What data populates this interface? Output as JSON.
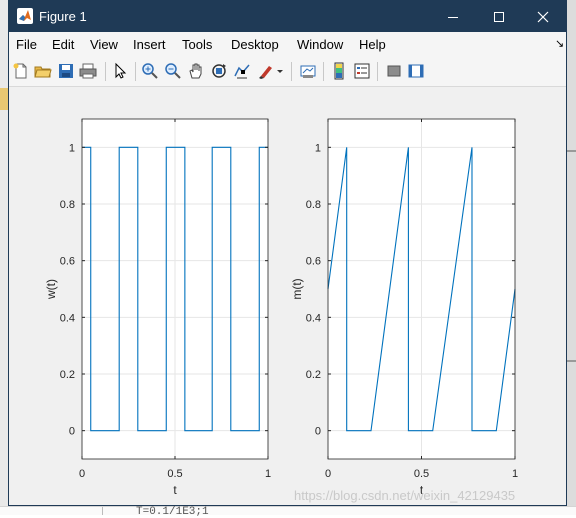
{
  "window": {
    "title": "Figure 1"
  },
  "menu": [
    "File",
    "Edit",
    "View",
    "Insert",
    "Tools",
    "Desktop",
    "Window",
    "Help"
  ],
  "toolbar": [
    "new-figure-icon",
    "open-file-icon",
    "save-icon",
    "print-icon",
    "pointer-icon",
    "zoom-in-icon",
    "zoom-out-icon",
    "pan-icon",
    "rotate-3d-icon",
    "data-cursor-icon",
    "brush-icon",
    "brush-dropdown-icon",
    "link-plot-icon",
    "colorbar-icon",
    "legend-icon",
    "hide-plot-tools-icon",
    "show-plot-tools-icon"
  ],
  "background_code": "T=0.1/1E3;1",
  "watermark": "https://blog.csdn.net/weixin_42129435",
  "chart_data": [
    {
      "type": "line",
      "xlabel": "t",
      "ylabel": "w(t)",
      "xlim": [
        0,
        1
      ],
      "ylim": [
        -0.1,
        1.1
      ],
      "xticks": [
        "0",
        "0.5",
        "1"
      ],
      "yticks": [
        "0",
        "0.2",
        "0.4",
        "0.6",
        "0.8",
        "1"
      ],
      "grid": true,
      "color": "#0072bd",
      "x": [
        0,
        0.047,
        0.047,
        0.2,
        0.2,
        0.3,
        0.3,
        0.453,
        0.453,
        0.553,
        0.553,
        0.7,
        0.7,
        0.8,
        0.8,
        0.953,
        0.953,
        1
      ],
      "y": [
        1,
        1,
        0,
        0,
        1,
        1,
        0,
        0,
        1,
        1,
        0,
        0,
        1,
        1,
        0,
        0,
        1,
        1
      ]
    },
    {
      "type": "line",
      "xlabel": "t",
      "ylabel": "m(t)",
      "xlim": [
        0,
        1
      ],
      "ylim": [
        -0.1,
        1.1
      ],
      "xticks": [
        "0",
        "0.5",
        "1"
      ],
      "yticks": [
        "0",
        "0.2",
        "0.4",
        "0.6",
        "0.8",
        "1"
      ],
      "grid": true,
      "color": "#0072bd",
      "x": [
        0,
        0.1,
        0.1,
        0.23,
        0.43,
        0.43,
        0.56,
        0.77,
        0.77,
        0.9,
        1
      ],
      "y": [
        0.5,
        1,
        0,
        0,
        1,
        0,
        0,
        1,
        0,
        0,
        0.5
      ]
    }
  ]
}
